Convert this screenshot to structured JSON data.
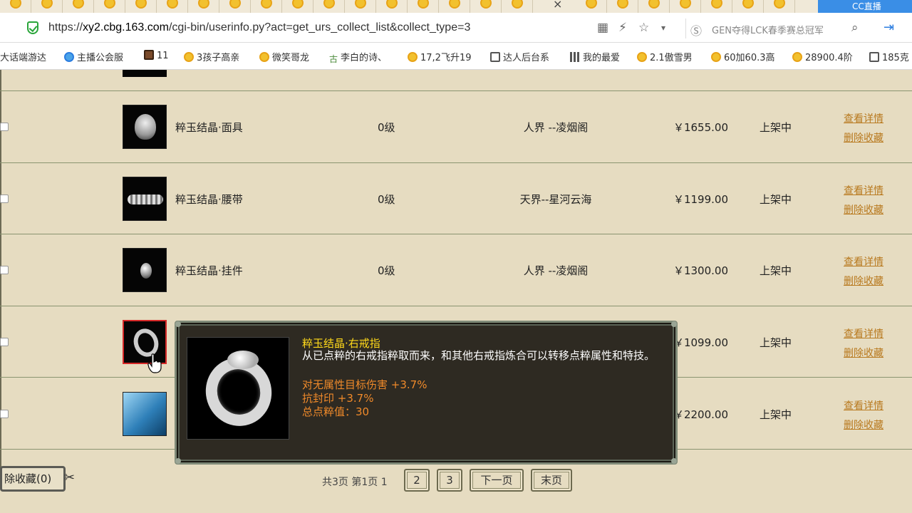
{
  "browser": {
    "url_scheme": "https://",
    "url_host": "xy2.cbg.163.com",
    "url_path": "/cgi-bin/userinfo.py?act=get_urs_collect_list&collect_type=3",
    "search_text": "GEN夺得LCK春季赛总冠军",
    "close_tab": "×",
    "live_tab_label": "CC直播"
  },
  "bookmarks": [
    {
      "label": "大话端游达",
      "icon": "none"
    },
    {
      "label": "主播公会服",
      "icon": "blue"
    },
    {
      "label": "11",
      "icon": "char"
    },
    {
      "label": "3孩子高亲",
      "icon": "coin"
    },
    {
      "label": "微笑哥龙",
      "icon": "coin"
    },
    {
      "label": "李白的诗、",
      "icon": "tree"
    },
    {
      "label": "17,2飞升19",
      "icon": "coin"
    },
    {
      "label": "达人后台系",
      "icon": "doc"
    },
    {
      "label": "我的最爱",
      "icon": "grid"
    },
    {
      "label": "2.1傲雪男",
      "icon": "coin"
    },
    {
      "label": "60加60.3高",
      "icon": "coin"
    },
    {
      "label": "28900.4阶",
      "icon": "coin"
    },
    {
      "label": "185克",
      "icon": "doc"
    }
  ],
  "items": [
    {
      "name": "粹玉结晶·面具",
      "level": "0级",
      "server": "人界 --凌烟阁",
      "price": "￥1655.00",
      "status": "上架中",
      "thumb": "mask"
    },
    {
      "name": "粹玉结晶·腰带",
      "level": "0级",
      "server": "天界--星河云海",
      "price": "￥1199.00",
      "status": "上架中",
      "thumb": "belt"
    },
    {
      "name": "粹玉结晶·挂件",
      "level": "0级",
      "server": "人界 --凌烟阁",
      "price": "￥1300.00",
      "status": "上架中",
      "thumb": "pend"
    },
    {
      "name": "",
      "level": "",
      "server": "",
      "price": "￥1099.00",
      "status": "上架中",
      "thumb": "ring"
    },
    {
      "name": "",
      "level": "",
      "server": "",
      "price": "￥2200.00",
      "status": "上架中",
      "thumb": "blue"
    }
  ],
  "links": {
    "detail": "查看详情",
    "remove": "删除收藏"
  },
  "pager": {
    "summary": "共3页 第1页 1",
    "page2": "2",
    "page3": "3",
    "next": "下一页",
    "last": "末页"
  },
  "remove_button": "除收藏(0)",
  "tooltip": {
    "title": "粹玉结晶·右戒指",
    "desc": "从已点粹的右戒指粹取而来，和其他右戒指炼合可以转移点粹属性和特技。",
    "attrs": [
      "对无属性目标伤害 +3.7%",
      "抗封印 +3.7%",
      "总点粹值：30"
    ]
  },
  "colors": {
    "link": "#b8791e",
    "tooltip_title": "#ffd91a",
    "tooltip_attr": "#f08a2a"
  }
}
